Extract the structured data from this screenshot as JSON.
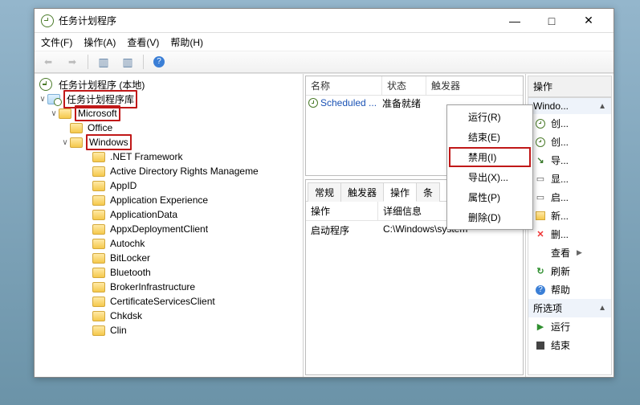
{
  "window": {
    "title": "任务计划程序"
  },
  "menu": {
    "file": "文件(F)",
    "action": "操作(A)",
    "view": "查看(V)",
    "help": "帮助(H)"
  },
  "tree": {
    "root": "任务计划程序 (本地)",
    "lib": "任务计划程序库",
    "microsoft": "Microsoft",
    "office": "Office",
    "windows": "Windows",
    "children": [
      ".NET Framework",
      "Active Directory Rights Manageme",
      "AppID",
      "Application Experience",
      "ApplicationData",
      "AppxDeploymentClient",
      "Autochk",
      "BitLocker",
      "Bluetooth",
      "BrokerInfrastructure",
      "CertificateServicesClient",
      "Chkdsk",
      "Clin"
    ]
  },
  "grid": {
    "headers": {
      "name": "名称",
      "status": "状态",
      "trigger": "触发器"
    },
    "row": {
      "name": "Scheduled ...",
      "status": "准备就绪",
      "trigger": ""
    }
  },
  "context": {
    "run": "运行(R)",
    "end": "结束(E)",
    "disable": "禁用(I)",
    "export": "导出(X)...",
    "properties": "属性(P)",
    "delete": "删除(D)"
  },
  "tabs": {
    "general": "常规",
    "triggers": "触发器",
    "actions": "操作",
    "conditions": "条"
  },
  "props": {
    "h_action": "操作",
    "h_detail": "详细信息",
    "r_action": "启动程序",
    "r_detail": "C:\\Windows\\system"
  },
  "actions": {
    "header": "操作",
    "section1": "Windo...",
    "create_basic": "创...",
    "create": "创...",
    "import": "导...",
    "view_running": "显...",
    "enable_history": "启...",
    "new_folder": "新...",
    "delete_folder": "删...",
    "view": "查看",
    "refresh": "刷新",
    "help": "帮助",
    "section2": "所选项",
    "run": "运行",
    "end": "结束"
  }
}
